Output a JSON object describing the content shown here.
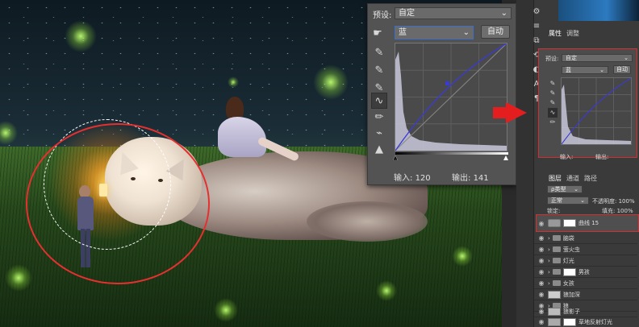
{
  "curves_dialog": {
    "preset_label": "预设:",
    "preset_value": "自定",
    "channel_value": "蓝",
    "auto_button": "自动",
    "input_label": "输入:",
    "input_value": "120",
    "output_label": "输出:",
    "output_value": "141"
  },
  "right_panel": {
    "tab_properties": "属性",
    "tab_adjust": "调整",
    "mini_preset_label": "预设:",
    "mini_preset_value": "自定",
    "mini_channel_value": "蓝",
    "mini_auto": "自动",
    "mini_input": "输入:",
    "mini_output": "输出:",
    "layers_tab": "图层",
    "channels_tab": "通道",
    "paths_tab": "路径",
    "kind_label": "ρ类型",
    "blend_mode": "正常",
    "opacity_label": "不透明度:",
    "opacity_value": "100%",
    "lock_label": "锁定:",
    "fill_label": "填充:",
    "fill_value": "100%",
    "layers": [
      {
        "name": "曲线 15",
        "type": "adjustment"
      },
      {
        "name": "脑袋",
        "type": "folder"
      },
      {
        "name": "萤火虫",
        "type": "folder"
      },
      {
        "name": "灯光",
        "type": "folder"
      },
      {
        "name": "男孩",
        "type": "folder-mask"
      },
      {
        "name": "女孩",
        "type": "folder"
      },
      {
        "name": "狼加深",
        "type": "layer"
      },
      {
        "name": "狼",
        "type": "folder"
      },
      {
        "name": "狼影子",
        "type": "layer"
      },
      {
        "name": "草地反射灯光",
        "type": "layer"
      }
    ]
  },
  "colors": {
    "annotation_red": "#e53030",
    "curve_blue": "#3a3ad8",
    "histogram": "#c8c8dc"
  }
}
